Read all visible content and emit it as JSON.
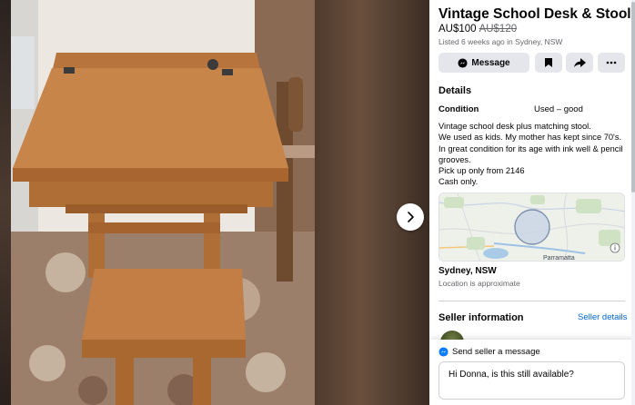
{
  "listing": {
    "title": "Vintage School Desk & Stool",
    "price": "AU$100",
    "original_price": "AU$120",
    "listed_meta": "Listed 6 weeks ago in Sydney, NSW"
  },
  "actions": {
    "message_label": "Message"
  },
  "details": {
    "heading": "Details",
    "condition_label": "Condition",
    "condition_value": "Used – good",
    "description": "Vintage school desk plus matching stool.\nWe used as kids. My mother has kept since 70's.\nIn great condition for its age with ink well & pencil grooves.\nPick up only from 2146\nCash only."
  },
  "map": {
    "place_label": "Parramatta",
    "location": "Sydney, NSW",
    "note": "Location is approximate"
  },
  "seller": {
    "heading": "Seller information",
    "details_link": "Seller details"
  },
  "message_box": {
    "header": "Send seller a message",
    "input_value": "Hi Donna, is this still available?"
  },
  "icons": {
    "next": "chevron-right-icon",
    "messenger": "messenger-icon",
    "save": "bookmark-icon",
    "share": "share-icon",
    "more": "more-icon",
    "info": "info-icon"
  },
  "colors": {
    "link": "#0064d1",
    "button_bg": "#e4e6eb",
    "secondary_text": "#65676b"
  }
}
